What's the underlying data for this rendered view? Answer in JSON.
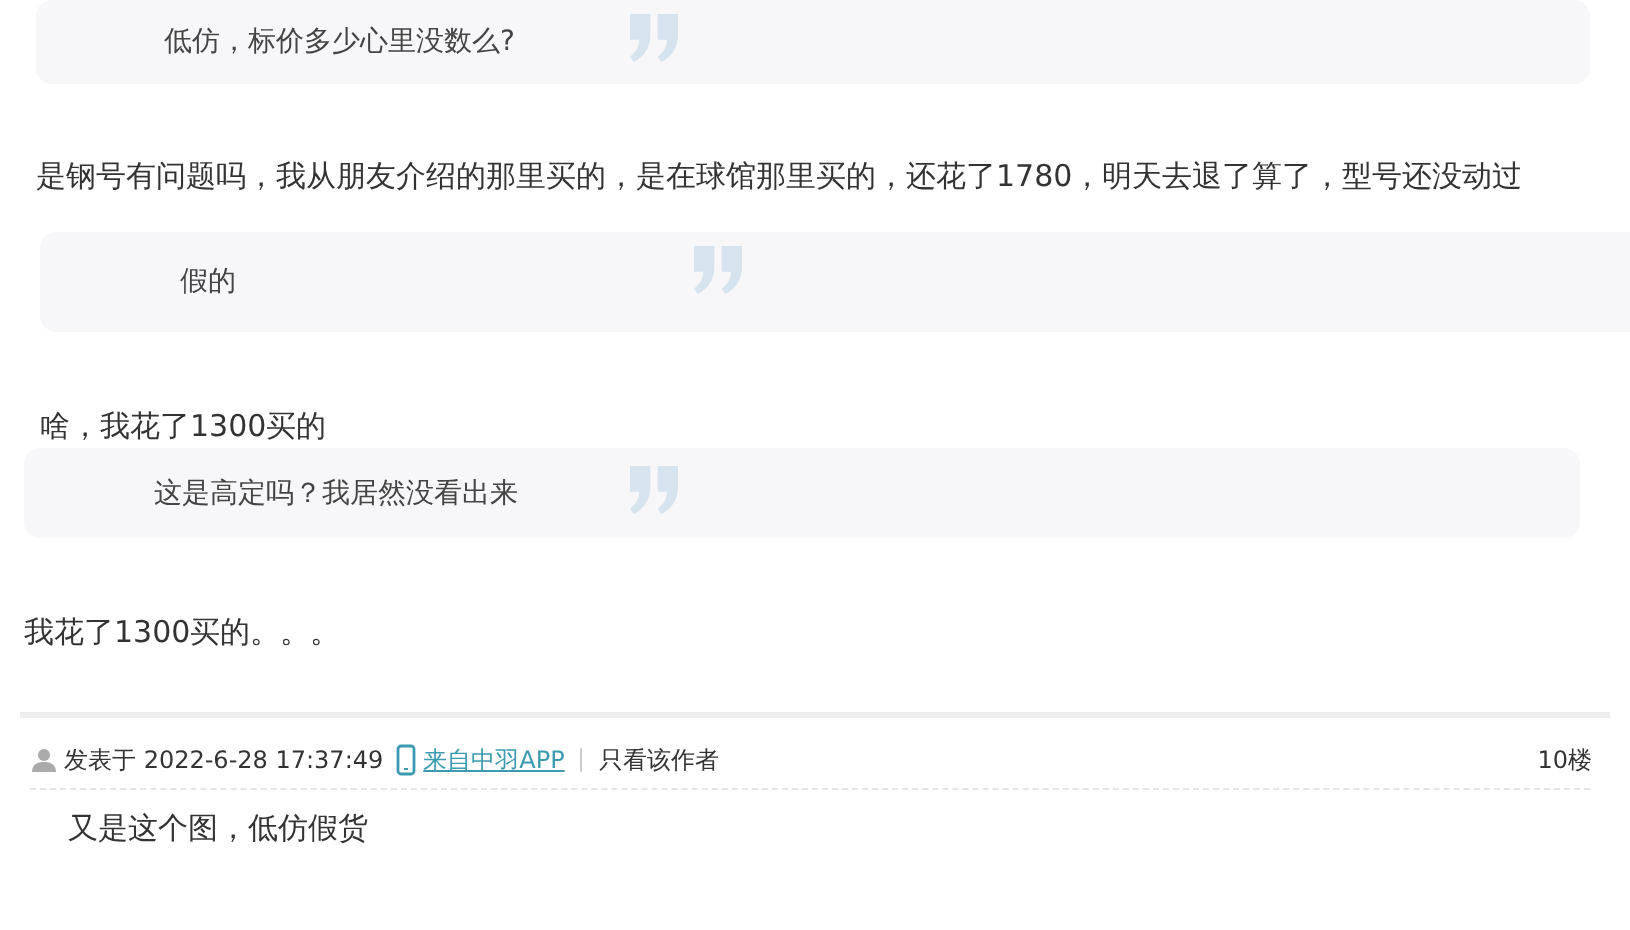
{
  "blocks": [
    {
      "kind": "quote",
      "text": "低仿，标价多少心里没数么?"
    },
    {
      "kind": "text",
      "text": "是钢号有问题吗，我从朋友介绍的那里买的，是在球馆那里买的，还花了1780，明天去退了算了，型号还没动过"
    },
    {
      "kind": "quote",
      "text": "假的"
    },
    {
      "kind": "text",
      "text": "啥，我花了1300买的"
    },
    {
      "kind": "quote",
      "text": "这是高定吗？我居然没看出来"
    },
    {
      "kind": "text",
      "text": "我花了1300买的。。。"
    }
  ],
  "post": {
    "posted": "发表于 2022-6-28 17:37:49",
    "source_link": "来自中羽APP",
    "author_only": "只看该作者",
    "floor": "10楼",
    "body": "又是这个图，低仿假货"
  }
}
